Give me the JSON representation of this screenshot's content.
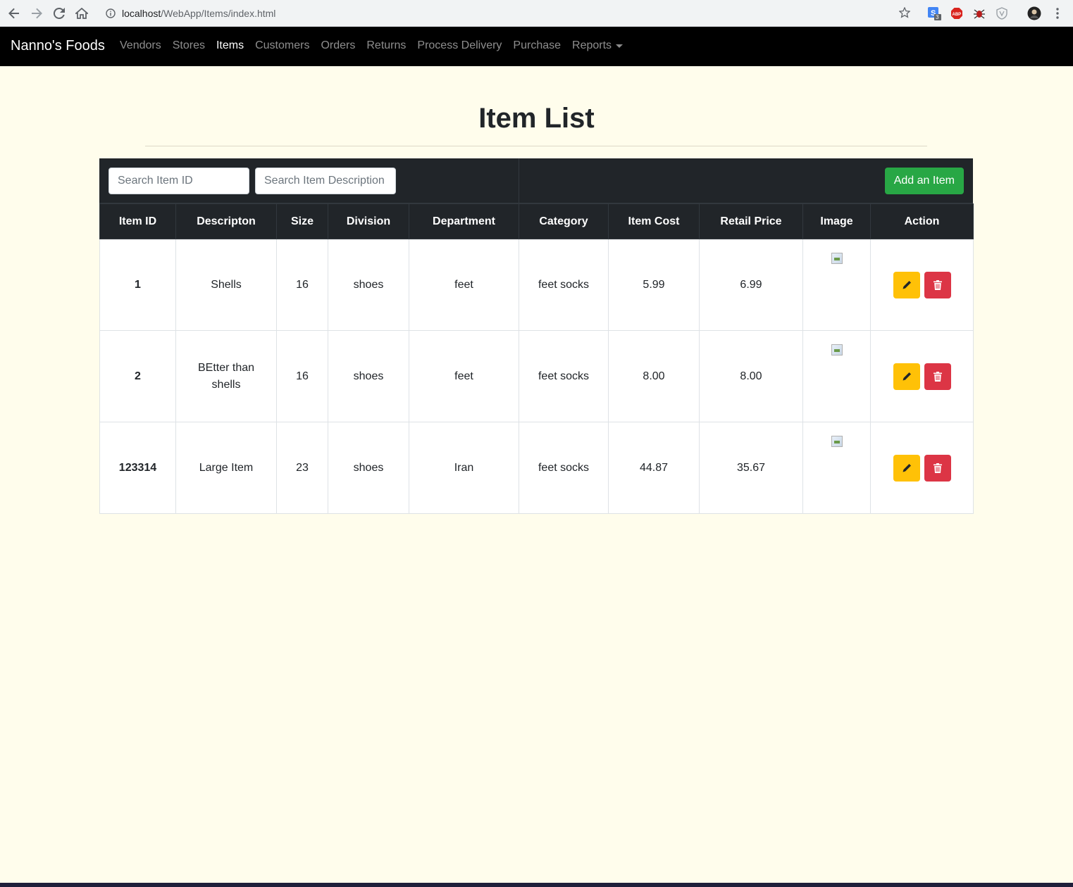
{
  "browser": {
    "url_host": "localhost",
    "url_path": "/WebApp/Items/index.html",
    "ext_badge": "3"
  },
  "navbar": {
    "brand": "Nanno's Foods",
    "links": [
      {
        "label": "Vendors"
      },
      {
        "label": "Stores"
      },
      {
        "label": "Items"
      },
      {
        "label": "Customers"
      },
      {
        "label": "Orders"
      },
      {
        "label": "Returns"
      },
      {
        "label": "Process Delivery"
      },
      {
        "label": "Purchase"
      },
      {
        "label": "Reports"
      }
    ],
    "active": "Items"
  },
  "page": {
    "title": "Item List"
  },
  "toolbar": {
    "search_id_placeholder": "Search Item ID",
    "search_desc_placeholder": "Search Item Description",
    "add_label": "Add an Item"
  },
  "table": {
    "headers": [
      "Item ID",
      "Descripton",
      "Size",
      "Division",
      "Department",
      "Category",
      "Item Cost",
      "Retail Price",
      "Image",
      "Action"
    ],
    "rows": [
      {
        "id": "1",
        "description": "Shells",
        "size": "16",
        "division": "shoes",
        "department": "feet",
        "category": "feet socks",
        "cost": "5.99",
        "retail": "6.99"
      },
      {
        "id": "2",
        "description": "BEtter than shells",
        "size": "16",
        "division": "shoes",
        "department": "feet",
        "category": "feet socks",
        "cost": "8.00",
        "retail": "8.00"
      },
      {
        "id": "123314",
        "description": "Large Item",
        "size": "23",
        "division": "shoes",
        "department": "Iran",
        "category": "feet socks",
        "cost": "44.87",
        "retail": "35.67"
      }
    ]
  },
  "colors": {
    "navbar_bg": "#000000",
    "page_bg": "#fffdec",
    "table_header_bg": "#212529",
    "add_button": "#28a745",
    "edit_button": "#ffc107",
    "delete_button": "#dc3545"
  },
  "icons": {
    "edit": "pencil-icon",
    "delete": "trash-icon",
    "image": "broken-image-icon"
  }
}
